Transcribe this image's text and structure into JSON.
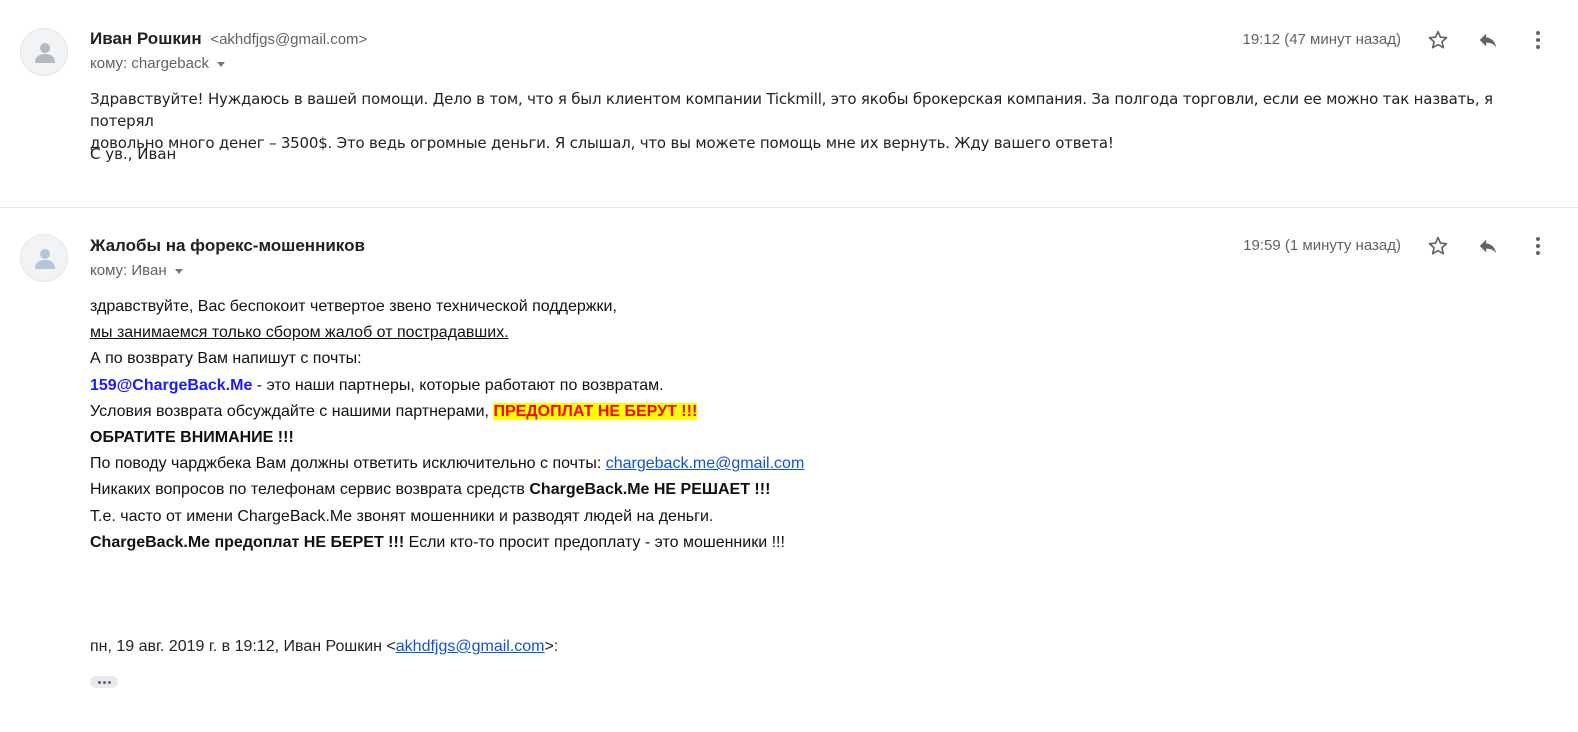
{
  "messages": [
    {
      "sender_name": "Иван Рошкин",
      "sender_email": "<akhdfjgs@gmail.com>",
      "to": "кому: chargeback",
      "time": "19:12 (47 минут назад)",
      "body_line1": "Здравствуйте! Нуждаюсь в вашей помощи. Дело в том, что я был клиентом компании Tickmill, это якобы брокерская компания. За полгода торговли, если ее можно так назвать, я потерял",
      "body_line2": "довольно много денег – 3500$. Это ведь огромные деньги. Я слышал, что вы можете помощь мне их вернуть. Жду вашего ответа!",
      "signature": "С ув., Иван"
    },
    {
      "sender_name": "Жалобы на форекс-мошенников",
      "to": "кому: Иван",
      "time": "19:59 (1 минуту назад)",
      "lines": {
        "l1": "здравствуйте, Вас беспокоит четвертое звено технической поддержки,",
        "l2": "мы занимаемся только сбором жалоб от пострадавших.",
        "l3": "А по возврату Вам напишут с почты:",
        "l4_email": "159@ChargeBack.Me",
        "l4_rest": " - это наши партнеры, которые работают по возвратам.",
        "l5_text": "Условия возврата обсуждайте с нашими партнерами, ",
        "l5_warn": "ПРЕДОПЛАТ НЕ БЕРУТ !!!",
        "l6": "ОБРАТИТЕ ВНИМАНИЕ !!!",
        "l7_text": "По поводу чарджбека Вам должны ответить исключительно с почты: ",
        "l7_link": "chargeback.me@gmail.com",
        "l8_text": "Никаких вопросов по телефонам сервис возврата средств ",
        "l8_bold": "ChargeBack.Me НЕ РЕШАЕТ !!!",
        "l9": "Т.е. часто от имени ChargeBack.Me звонят мошенники и разводят людей на деньги.",
        "l10_bold": "ChargeBack.Me предоплат НЕ БЕРЕТ !!!",
        "l10_rest": " Если кто-то просит предоплату - это мошенники !!!"
      },
      "quote_prefix": "пн, 19 авг. 2019 г. в 19:12, Иван Рошкин <",
      "quote_email": "akhdfjgs@gmail.com",
      "quote_suffix": ">:"
    }
  ],
  "icons": [
    "person-icon",
    "star-icon",
    "reply-icon",
    "more-vert-icon",
    "caret-down-icon",
    "ellipsis-icon"
  ]
}
